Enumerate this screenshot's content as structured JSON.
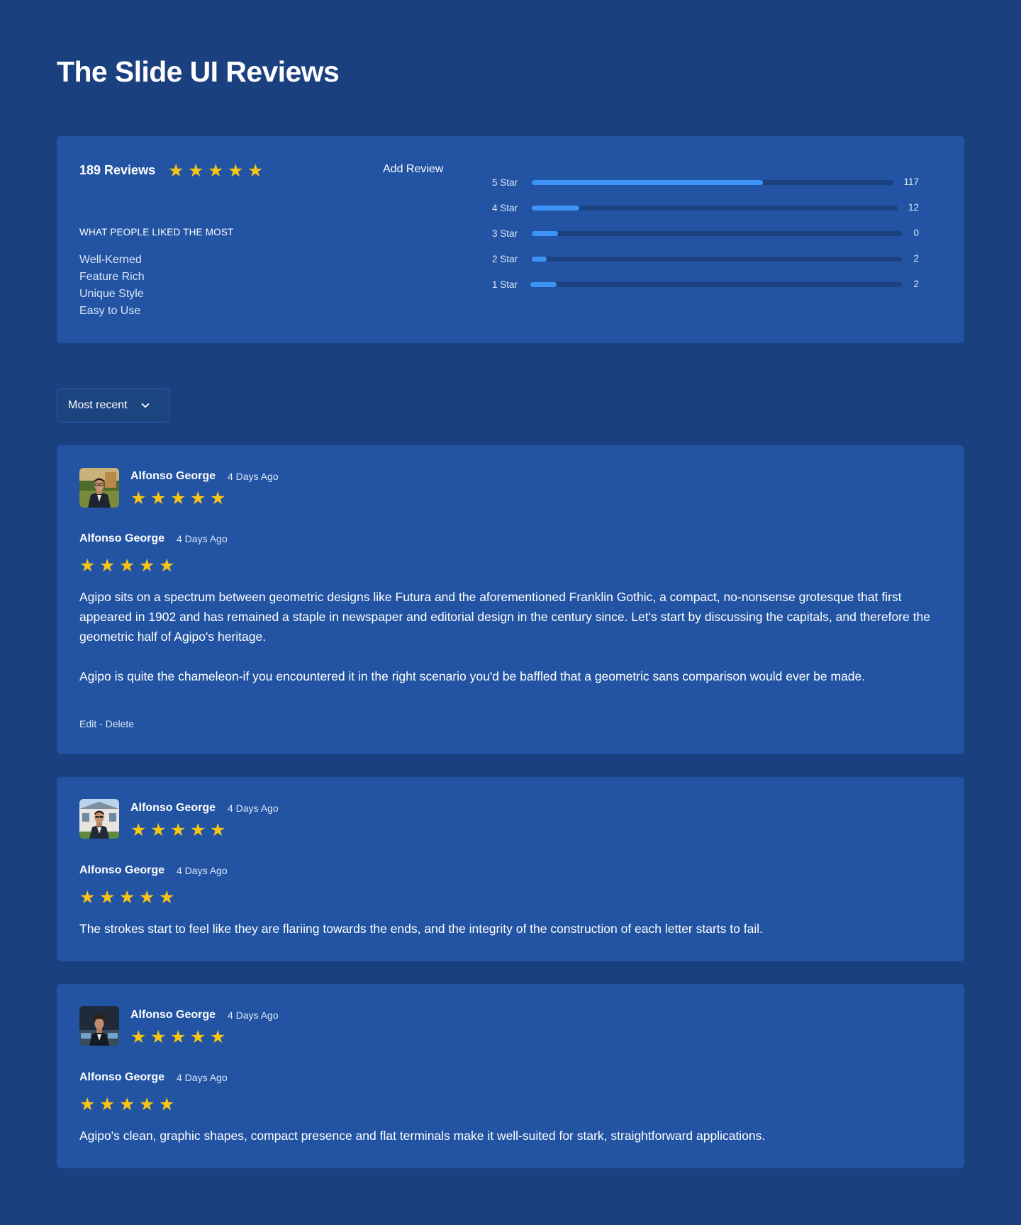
{
  "page": {
    "title": "The Slide UI Reviews"
  },
  "summary": {
    "reviews_label": "189 Reviews",
    "average_stars": 5,
    "add_review_label": "Add Review",
    "liked_heading": "WHAT PEOPLE LIKED THE MOST",
    "liked_items": [
      "Well-Kerned",
      "Feature Rich",
      "Unique Style",
      "Easy to Use"
    ],
    "breakdown": [
      {
        "label": "5 Star",
        "count": "117",
        "fill_fraction": 0.64
      },
      {
        "label": "4 Star",
        "count": "12",
        "fill_fraction": 0.13
      },
      {
        "label": "3 Star",
        "count": "0",
        "fill_fraction": 0.07
      },
      {
        "label": "2 Star",
        "count": "2",
        "fill_fraction": 0.04
      },
      {
        "label": "1 Star",
        "count": "2",
        "fill_fraction": 0.07
      }
    ]
  },
  "sort": {
    "selected": "Most recent"
  },
  "reviews": [
    {
      "author": "Alfonso George",
      "date": "4 Days Ago",
      "rating": 5,
      "body_author": "Alfonso George",
      "body_date": "4 Days Ago",
      "body_rating": 5,
      "paragraphs": [
        "Agipo sits on a spectrum between geometric designs like Futura and the aforementioned Franklin Gothic, a compact, no-nonsense grotesque that first appeared in 1902 and has remained a staple in newspaper and editorial design in the century since. Let's start by discussing the capitals, and therefore the geometric half of Agipo's heritage.",
        "Agipo is quite the chameleon-if you encountered it in the right scenario you'd be baffled that a geometric sans comparison would ever be made."
      ],
      "edit_label": "Edit",
      "separator": " - ",
      "delete_label": "Delete"
    },
    {
      "author": "Alfonso George",
      "date": "4 Days Ago",
      "rating": 5,
      "body_author": "Alfonso George",
      "body_date": "4 Days Ago",
      "body_rating": 5,
      "paragraphs": [
        "The strokes start to feel like they are flariing towards the ends, and the integrity of the construction of each letter starts to fail."
      ]
    },
    {
      "author": "Alfonso George",
      "date": "4 Days Ago",
      "rating": 5,
      "body_author": "Alfonso George",
      "body_date": "4 Days Ago",
      "body_rating": 5,
      "paragraphs": [
        "Agipo's clean, graphic shapes, compact presence and flat terminals make it well-suited for stark, straightforward applications."
      ]
    }
  ],
  "colors": {
    "background": "#1b4080",
    "card": "#2254a3",
    "star": "#f8c514",
    "bar_fill": "#3d94f6",
    "bar_track": "#1b427f"
  }
}
